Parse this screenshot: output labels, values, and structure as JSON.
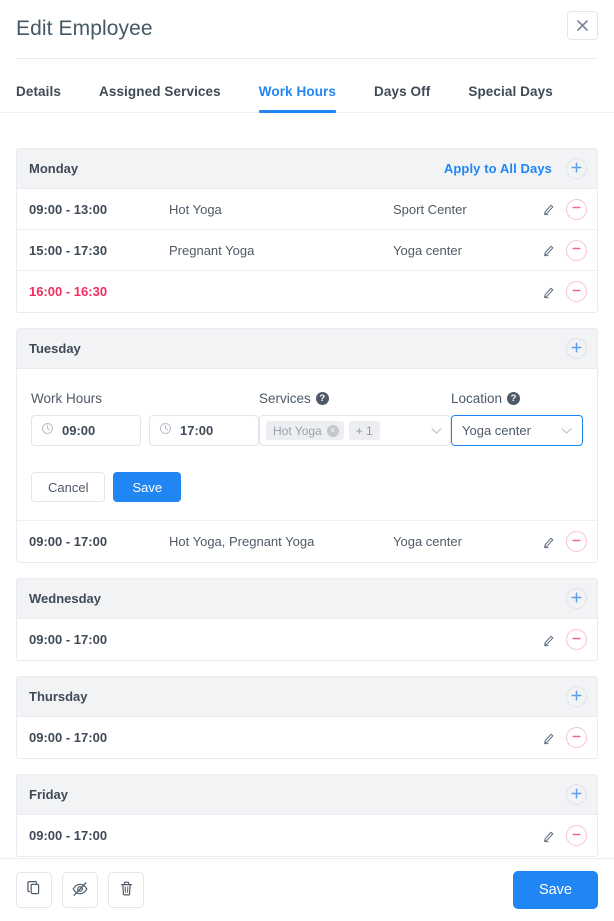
{
  "header": {
    "title": "Edit Employee",
    "close_label": "×"
  },
  "tabs": [
    {
      "label": "Details",
      "active": false
    },
    {
      "label": "Assigned Services",
      "active": false
    },
    {
      "label": "Work Hours",
      "active": true
    },
    {
      "label": "Days Off",
      "active": false
    },
    {
      "label": "Special Days",
      "active": false
    }
  ],
  "colors": {
    "accent": "#2086f3",
    "danger": "#f42b5f",
    "header_bg": "#f2f3f5",
    "text": "#3f4a57",
    "muted": "#4e5a68"
  },
  "days": [
    {
      "name": "Monday",
      "apply_all_label": "Apply to All Days",
      "add_label": "+",
      "rows": [
        {
          "time": "09:00 - 13:00",
          "services": "Hot Yoga",
          "location": "Sport Center",
          "alt": false
        },
        {
          "time": "15:00 - 17:30",
          "services": "Pregnant Yoga",
          "location": "Yoga center",
          "alt": false
        },
        {
          "time": "16:00 - 16:30",
          "services": "",
          "location": "",
          "alt": true
        }
      ]
    },
    {
      "name": "Tuesday",
      "apply_all_label": "",
      "add_label": "+",
      "rows": [
        {
          "time": "09:00 - 17:00",
          "services": "Hot Yoga, Pregnant Yoga",
          "location": "Yoga center",
          "alt": false
        }
      ]
    },
    {
      "name": "Wednesday",
      "apply_all_label": "",
      "add_label": "+",
      "rows": [
        {
          "time": "09:00 - 17:00",
          "services": "",
          "location": "",
          "alt": false
        }
      ]
    },
    {
      "name": "Thursday",
      "apply_all_label": "",
      "add_label": "+",
      "rows": [
        {
          "time": "09:00 - 17:00",
          "services": "",
          "location": "",
          "alt": false
        }
      ]
    },
    {
      "name": "Friday",
      "apply_all_label": "",
      "add_label": "+",
      "rows": [
        {
          "time": "09:00 - 17:00",
          "services": "",
          "location": "",
          "alt": false
        }
      ]
    }
  ],
  "edit_form": {
    "work_hours_label": "Work Hours",
    "services_label": "Services",
    "location_label": "Location",
    "help_glyph": "?",
    "start_time": "09:00",
    "end_time": "17:00",
    "service_chip": "Hot Yoga",
    "service_chip_remove": "×",
    "service_more": "+ 1",
    "location_value": "Yoga center",
    "cancel_label": "Cancel",
    "save_label": "Save"
  },
  "footer": {
    "duplicate_title": "duplicate",
    "hide_title": "hide",
    "delete_title": "delete",
    "save_label": "Save"
  }
}
